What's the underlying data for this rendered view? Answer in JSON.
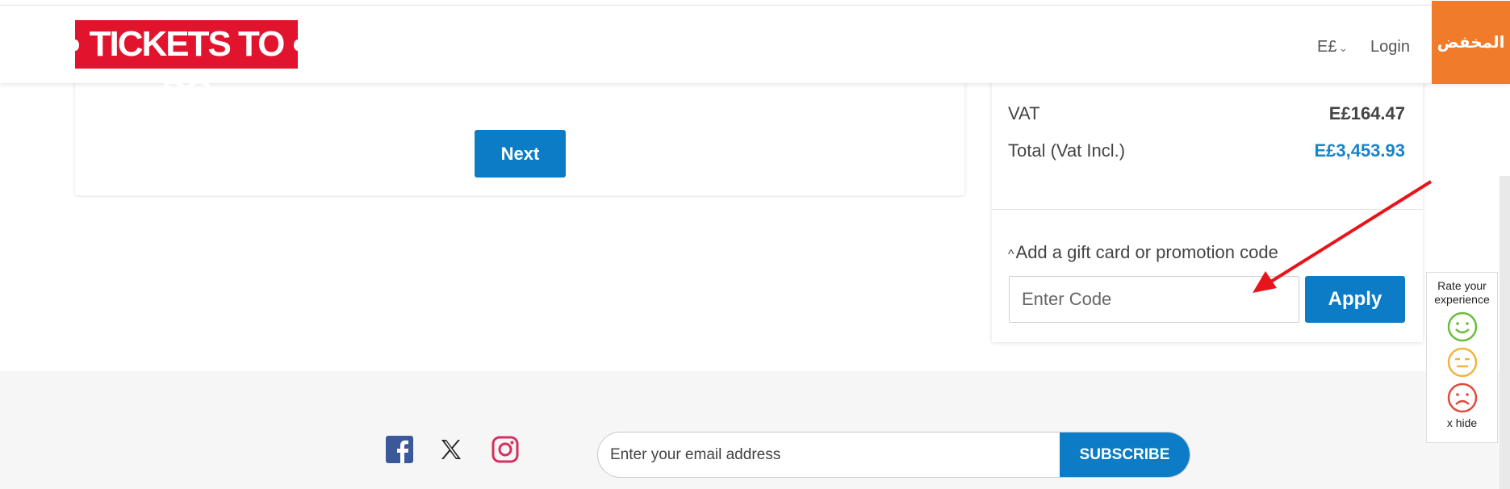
{
  "header": {
    "logo_text": "TICKETS TO DO",
    "currency": "E£",
    "login": "Login",
    "badge_text": "المخفض"
  },
  "form": {
    "next_label": "Next"
  },
  "summary": {
    "vat_label": "VAT",
    "vat_value": "E£164.47",
    "total_label": "Total (Vat Incl.)",
    "total_value": "E£3,453.93",
    "gift_toggle": "Add a gift card or promotion code",
    "code_placeholder": "Enter Code",
    "apply_label": "Apply"
  },
  "footer": {
    "social": [
      "facebook-icon",
      "x-icon",
      "instagram-icon"
    ],
    "email_placeholder": "Enter your email address",
    "subscribe_label": "SUBSCRIBE"
  },
  "rating": {
    "title": "Rate your experience",
    "hide": "x hide"
  },
  "colors": {
    "primary": "#0c7cc6",
    "logo_red": "#e2142d",
    "badge_orange": "#f07b2a",
    "total_blue": "#1a84c7"
  }
}
